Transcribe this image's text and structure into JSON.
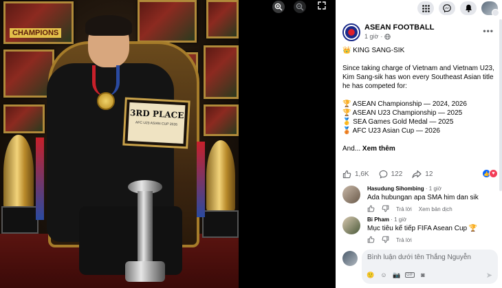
{
  "viewer": {
    "zoom_in_icon": "zoom-in-icon",
    "zoom_out_icon": "zoom-out-icon",
    "fullscreen_icon": "fullscreen-icon",
    "photo_texts": {
      "champions_banner": "CHAMPIONS",
      "plaque_title": "3RD PLACE",
      "plaque_subtitle": "AFC U23 ASIAN CUP 2026"
    }
  },
  "topbar": {
    "menu_icon": "grid-menu-icon",
    "messenger_icon": "messenger-icon",
    "notifications_icon": "bell-icon",
    "account_icon": "account-avatar"
  },
  "post": {
    "page_name": "ASEAN FOOTBALL",
    "time": "1 giờ",
    "privacy_icon": "globe-icon",
    "title_line": "👑 KING SANG-SIK",
    "paragraph": "Since taking charge of Vietnam and Vietnam U23, Kim Sang-sik has won every Southeast Asian title he has competed for:",
    "titles": [
      "🏆 ASEAN Championship — 2024, 2026",
      "🏆 ASEAN U23 Championship — 2025",
      "🥇 SEA Games Gold Medal — 2025",
      "🥉 AFC U23 Asian Cup — 2026"
    ],
    "ending": "And...",
    "see_more": "Xem thêm"
  },
  "reactions": {
    "like_count": "1,6K",
    "comment_count": "122",
    "share_count": "12"
  },
  "comments": [
    {
      "name": "Hasudung Sihombing",
      "time": "· 1 giờ",
      "text": "Ada hubungan apa SMA him dan sik",
      "actions": [
        "Trả lời",
        "Xem bản dịch"
      ]
    },
    {
      "name": "Bi Pham",
      "time": "· 1 giờ",
      "text": "Mục tiêu kế tiếp FIFA Asean Cup 🏆",
      "actions": [
        "Trả lời"
      ]
    }
  ],
  "composer": {
    "placeholder": "Bình luận dưới tên Thắng Nguyễn"
  },
  "colors": {
    "facebook_blue": "#0866ff",
    "love_red": "#f33e58",
    "text_secondary": "#65676b"
  }
}
